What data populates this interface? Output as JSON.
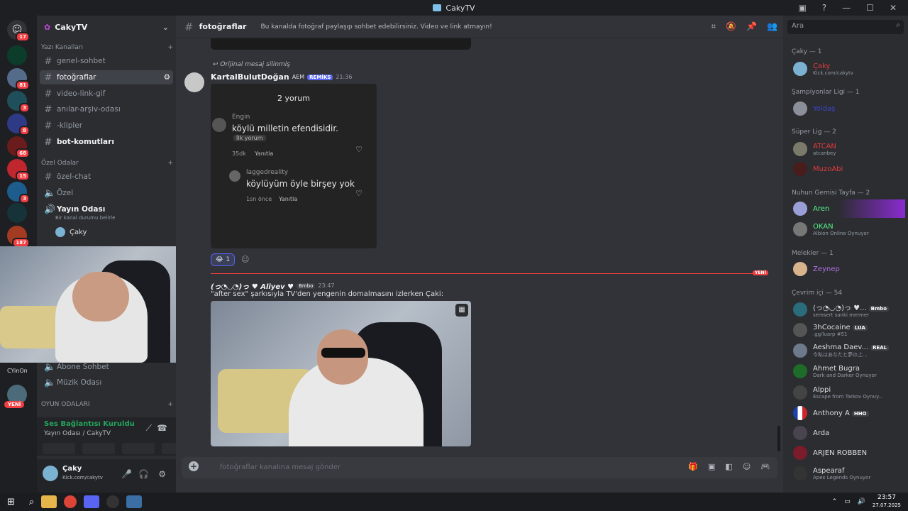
{
  "window": {
    "title": "CakyTV"
  },
  "servers": {
    "badges": [
      "17",
      "81",
      "3",
      "8",
      "68",
      "15",
      "3",
      "187"
    ],
    "new_label": "YENİ",
    "user_label": "CYinOn"
  },
  "guild": {
    "name": "CakyTV"
  },
  "channels": {
    "text_category": "Yazı Kanalları",
    "private_category": "Özel Odalar",
    "game_category": "OYUN ODALARI",
    "items": [
      {
        "name": "genel-sohbet"
      },
      {
        "name": "fotoğraflar"
      },
      {
        "name": "video-link-gif"
      },
      {
        "name": "anılar-arşiv-odası"
      },
      {
        "name": "-klipler"
      },
      {
        "name": "bot-komutları"
      }
    ],
    "private_items": [
      {
        "name": "özel-chat"
      },
      {
        "name": "Özel"
      },
      {
        "name": "Yayın Odası",
        "status": "Bir kanal durumu belirle"
      }
    ],
    "voice_user": "Çaky",
    "lower_items": [
      {
        "name": "Abone Sohbet"
      },
      {
        "name": "Müzik Odası"
      }
    ]
  },
  "voice": {
    "status": "Ses Bağlantısı Kuruldu",
    "location": "Yayın Odası / CakyTV"
  },
  "user": {
    "name": "Çaky",
    "sub": "Kick.com/cakytv"
  },
  "header": {
    "channel": "fotoğraflar",
    "topic": "Bu kanalda fotoğraf paylaşıp sohbet edebilirsiniz. Video ve link atmayın!"
  },
  "messages": {
    "reply_note": "Orijinal mesaj silinmiş",
    "m1": {
      "author": "KartalBulutDoğan",
      "tag1": "AEM",
      "tag2": "REMİKS",
      "time": "21:36"
    },
    "embed": {
      "count": "2 yorum",
      "c1_user": "Engin",
      "c1_text": "köylü milletin efendisidir.",
      "c1_badge": "İlk yorum",
      "c1_time": "35dk",
      "c1_reply": "Yanıtla",
      "c2_user": "laggedreality",
      "c2_text": "köylüyüm öyle birşey yok",
      "c2_time": "1sn önce",
      "c2_reply": "Yanıtla"
    },
    "reaction_count": "1",
    "new_label": "YENİ",
    "m2": {
      "author": "(っ◔◡◔)っ ♥ Aliyev ♥",
      "tag": "Bmbo",
      "time": "23:47",
      "text": "\"after sex\" şarkısıyla TV'den yengenin domalmasını izlerken Çaki:"
    }
  },
  "composer": {
    "placeholder": "fotoğraflar kanalına mesaj gönder"
  },
  "search": {
    "placeholder": "Ara"
  },
  "members": {
    "groups": [
      {
        "label": "Çaky — 1",
        "top": 0
      },
      {
        "label": "Şampiyonlar Ligi — 1"
      },
      {
        "label": "Süper Lig — 2"
      },
      {
        "label": "Nuhun Gemisi Tayfa — 2"
      },
      {
        "label": "Melekler — 1"
      },
      {
        "label": "Çevrim içi — 54"
      }
    ],
    "list": [
      {
        "name": "Çaky",
        "sub": "Kick.com/cakytv",
        "color": "#e23b3b"
      },
      {
        "name": "Yoldaş",
        "sub": "",
        "color": "#3d46c9"
      },
      {
        "name": "ATCAN",
        "sub": "atcanbey",
        "color": "#e23b3b"
      },
      {
        "name": "MuzoAbi",
        "sub": "",
        "color": "#e23b3b"
      },
      {
        "name": "Aren",
        "sub": "",
        "color": "#57f287"
      },
      {
        "name": "OKAN",
        "sub": "Albion Online Oynuyor",
        "color": "#57f287"
      },
      {
        "name": "Zeynep",
        "sub": "",
        "color": "#b36fe0"
      },
      {
        "name": "(っ◔◡◔)っ ♥...",
        "tag": "Bmbo",
        "sub": "semsert sanki mermer",
        "color": "#dbdee1"
      },
      {
        "name": "3hCocaine",
        "tag": "LUA",
        "sub": ".gg/luarp #S1",
        "color": "#dbdee1"
      },
      {
        "name": "Aeshma Daev...",
        "tag": "REAL",
        "sub": "今私はあなたと夢の上...",
        "color": "#dbdee1"
      },
      {
        "name": "Ahmet Bugra",
        "sub": "Dark and Darker Oynuyor",
        "color": "#dbdee1"
      },
      {
        "name": "Alppi",
        "sub": "Escape from Tarkov Oynuy...",
        "color": "#dbdee1"
      },
      {
        "name": "Anthony A",
        "tag": "HHO",
        "sub": "",
        "color": "#dbdee1"
      },
      {
        "name": "Arda",
        "sub": "",
        "color": "#dbdee1"
      },
      {
        "name": "ARJEN ROBBEN",
        "sub": "",
        "color": "#dbdee1"
      },
      {
        "name": "Aspearaf",
        "sub": "Apex Legends Oynuyor",
        "color": "#dbdee1"
      }
    ]
  },
  "clock": {
    "time": "23:57",
    "date": "27.07.2025"
  }
}
